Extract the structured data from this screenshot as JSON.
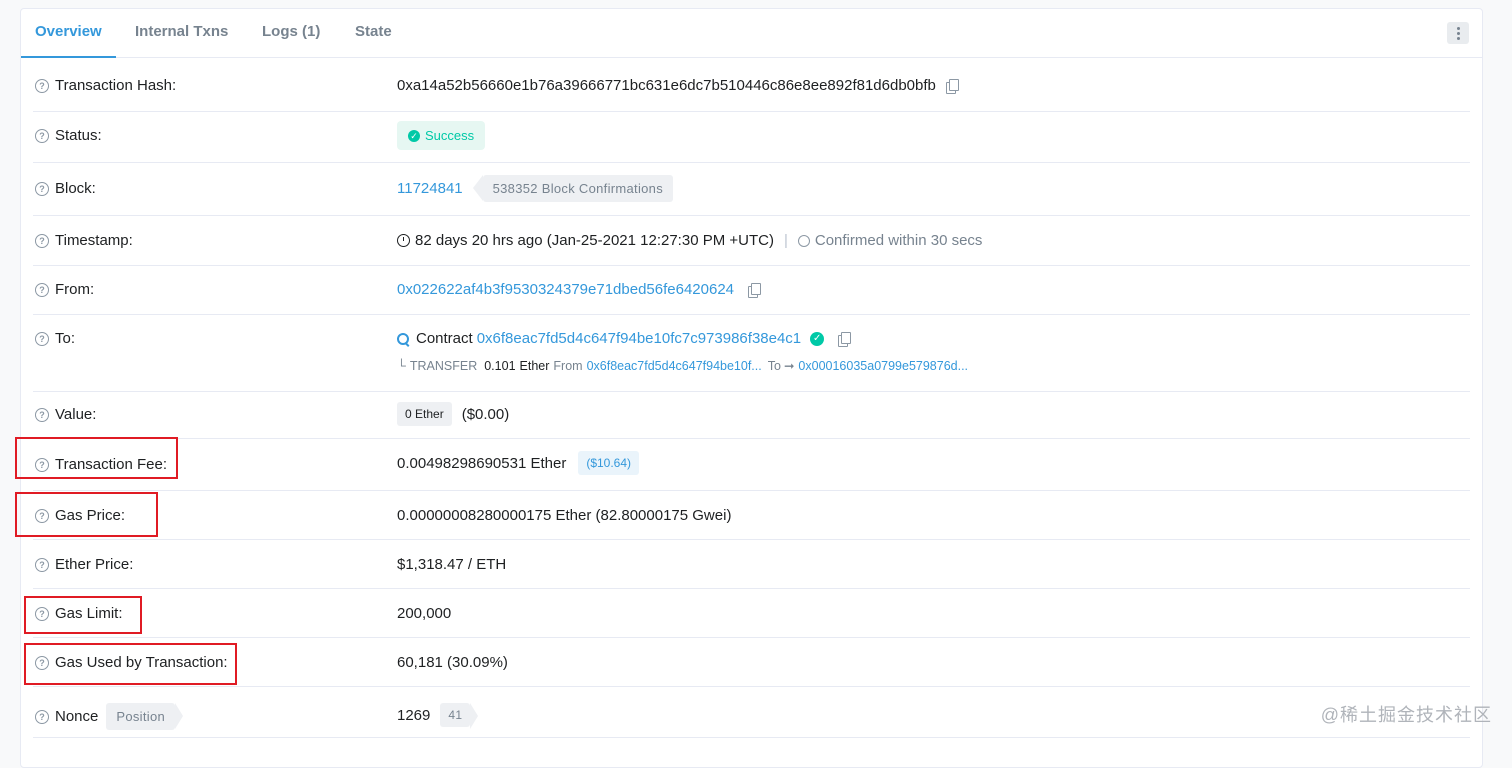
{
  "tabs": [
    {
      "label": "Overview",
      "active": true
    },
    {
      "label": "Internal Txns"
    },
    {
      "label": "Logs (1)"
    },
    {
      "label": "State"
    }
  ],
  "rows": {
    "hash": {
      "label": "Transaction Hash:",
      "value": "0xa14a52b56660e1b76a39666771bc631e6dc7b510446c86e8ee892f81d6db0bfb"
    },
    "status": {
      "label": "Status:",
      "value": "Success"
    },
    "block": {
      "label": "Block:",
      "value": "11724841",
      "confirmations": "538352 Block Confirmations"
    },
    "timestamp": {
      "label": "Timestamp:",
      "value": "82 days 20 hrs ago (Jan-25-2021 12:27:30 PM +UTC)",
      "confirmed": "Confirmed within 30 secs"
    },
    "from": {
      "label": "From:",
      "value": "0x022622af4b3f9530324379e71dbed56fe6420624"
    },
    "to": {
      "label": "To:",
      "prefix": "Contract",
      "value": "0x6f8eac7fd5d4c647f94be10fc7c973986f38e4c1",
      "transfer": {
        "kind": "TRANSFER",
        "amount": "0.101",
        "unit": "Ether",
        "from_label": "From",
        "from": "0x6f8eac7fd5d4c647f94be10f...",
        "to_label": "To",
        "to": "0x00016035a0799e579876d..."
      }
    },
    "value": {
      "label": "Value:",
      "tag": "0 Ether",
      "usd": "($0.00)"
    },
    "fee": {
      "label": "Transaction Fee:",
      "value": "0.00498298690531 Ether",
      "usd": "($10.64)"
    },
    "gas_price": {
      "label": "Gas Price:",
      "value": "0.00000008280000175 Ether (82.80000175 Gwei)"
    },
    "ether_price": {
      "label": "Ether Price:",
      "value": "$1,318.47 / ETH"
    },
    "gas_limit": {
      "label": "Gas Limit:",
      "value": "200,000"
    },
    "gas_used": {
      "label": "Gas Used by Transaction:",
      "value": "60,181 (30.09%)"
    },
    "nonce": {
      "label": "Nonce",
      "position": "Position",
      "value": "1269",
      "index": "41"
    }
  },
  "watermark": "@稀土掘金技术社区",
  "colors": {
    "link": "#3498db",
    "success": "#00c9a7",
    "highlight_box": "#e01b24"
  }
}
